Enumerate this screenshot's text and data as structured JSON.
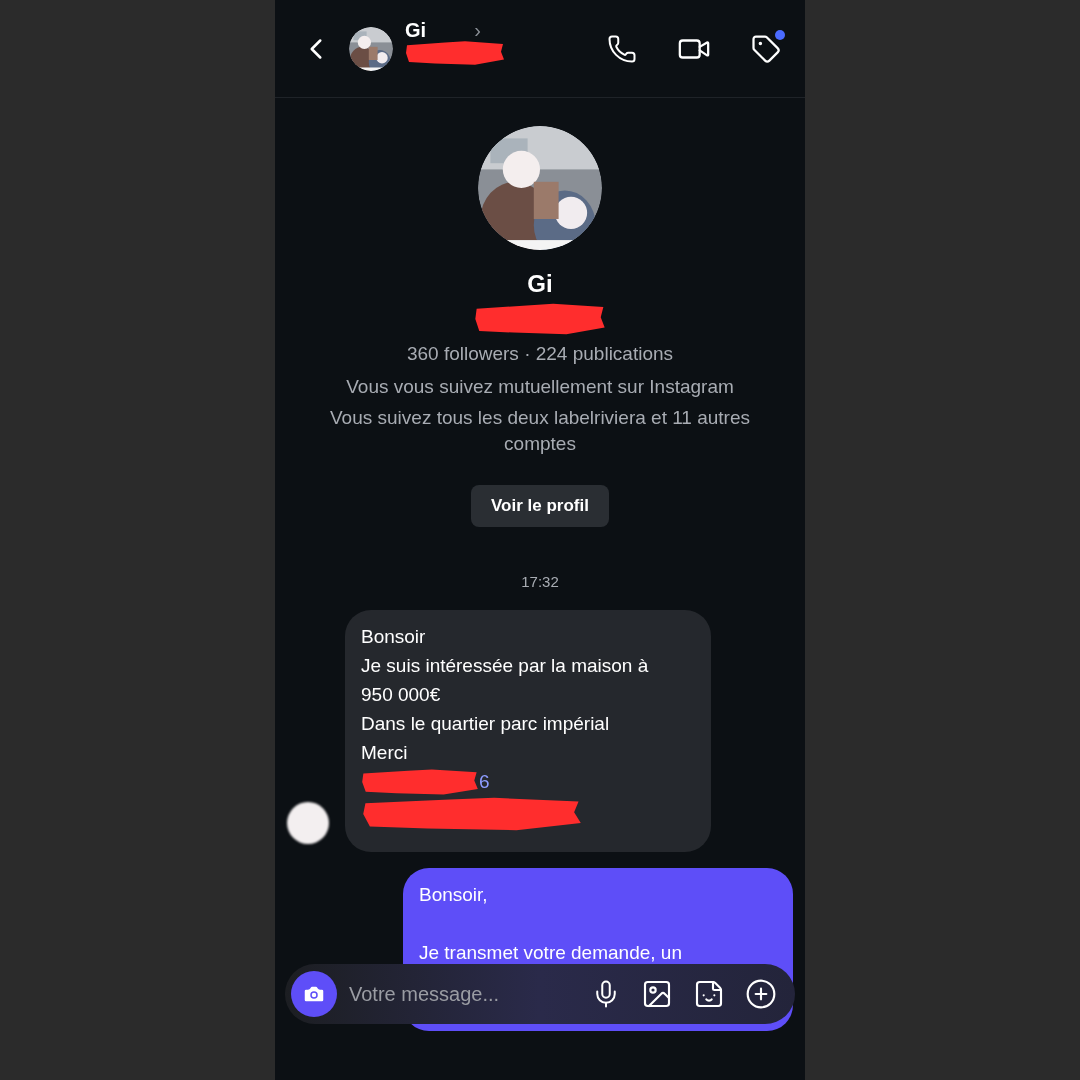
{
  "header": {
    "name": "Gi",
    "chevron": "›",
    "notification_dot": true
  },
  "profile": {
    "name": "Gi",
    "stats": "360 followers · 224 publications",
    "mutual": "Vous vous suivez mutuellement sur Instagram",
    "common": "Vous suivez tous les deux labelriviera et 11 autres comptes",
    "button": "Voir le profil"
  },
  "timestamp": "17:32",
  "messages": [
    {
      "kind": "received",
      "lines": [
        "Bonsoir",
        "Je suis intéressée par la maison à 950 000€",
        "Dans le quartier parc impérial",
        "Merci"
      ],
      "link_fragment": "6",
      "redacted": true
    },
    {
      "kind": "sent",
      "paragraphs": [
        "Bonsoir,",
        "Je transmet votre demande, un"
      ]
    }
  ],
  "composer": {
    "placeholder": "Votre message..."
  }
}
